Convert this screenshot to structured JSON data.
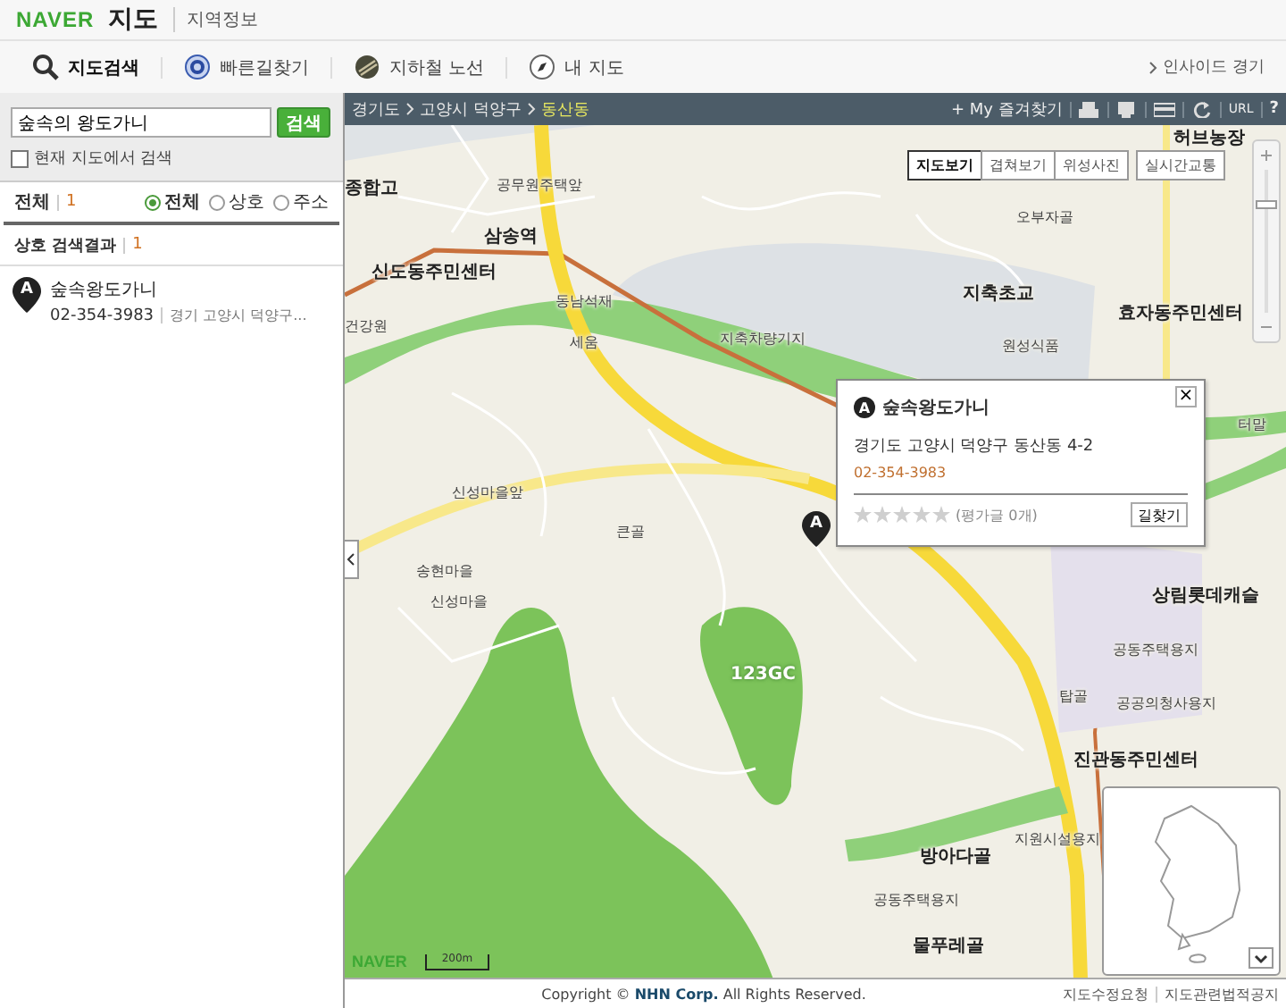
{
  "header": {
    "logo": "NAVER",
    "title": "지도",
    "subtitle": "지역정보"
  },
  "nav": {
    "items": [
      {
        "label": "지도검색",
        "selected": true
      },
      {
        "label": "빠른길찾기",
        "selected": false
      },
      {
        "label": "지하철 노선",
        "selected": false
      },
      {
        "label": "내 지도",
        "selected": false
      }
    ],
    "right_link": "인사이드 경기"
  },
  "search": {
    "value": "숲속의 왕도가니",
    "button": "검색",
    "scope_checkbox": {
      "label": "현재 지도에서 검색",
      "checked": false
    }
  },
  "filter": {
    "label": "전체",
    "count": "1",
    "options": [
      {
        "label": "전체",
        "selected": true
      },
      {
        "label": "상호",
        "selected": false
      },
      {
        "label": "주소",
        "selected": false
      }
    ]
  },
  "results": {
    "heading": "상호 검색결과",
    "count": "1",
    "items": [
      {
        "marker": "A",
        "name": "숲속왕도가니",
        "phone": "02-354-3983",
        "address": "경기 고양시 덕양구..."
      }
    ]
  },
  "map_toolbar": {
    "breadcrumb": [
      {
        "label": "경기도",
        "selected": false
      },
      {
        "label": "고양시 덕양구",
        "selected": false
      },
      {
        "label": "동산동",
        "selected": true
      }
    ],
    "favorites": "+ My 즐겨찾기",
    "url": "URL",
    "help": "?"
  },
  "map_types": [
    {
      "label": "지도보기",
      "selected": true
    },
    {
      "label": "겹쳐보기",
      "selected": false
    },
    {
      "label": "위성사진",
      "selected": false
    },
    {
      "label": "실시간교통",
      "selected": false
    }
  ],
  "map_labels": [
    {
      "text": "허브농장",
      "kind": "major"
    },
    {
      "text": "종합고",
      "kind": "major"
    },
    {
      "text": "공무원주택앞",
      "kind": "minor"
    },
    {
      "text": "삼송역",
      "kind": "major"
    },
    {
      "text": "신도동주민센터",
      "kind": "major"
    },
    {
      "text": "동남석재",
      "kind": "minor"
    },
    {
      "text": "건강원",
      "kind": "minor"
    },
    {
      "text": "세움",
      "kind": "minor"
    },
    {
      "text": "지축차량기지",
      "kind": "minor"
    },
    {
      "text": "오부자골",
      "kind": "minor"
    },
    {
      "text": "지축초교",
      "kind": "major"
    },
    {
      "text": "효자동주민센터",
      "kind": "major"
    },
    {
      "text": "원성식품",
      "kind": "minor"
    },
    {
      "text": "터말",
      "kind": "minor"
    },
    {
      "text": "신성마을앞",
      "kind": "minor"
    },
    {
      "text": "큰골",
      "kind": "minor"
    },
    {
      "text": "송현마을",
      "kind": "minor"
    },
    {
      "text": "신성마을",
      "kind": "minor"
    },
    {
      "text": "123GC",
      "kind": "golf"
    },
    {
      "text": "상림롯데캐슬",
      "kind": "major"
    },
    {
      "text": "공동주택용지",
      "kind": "minor"
    },
    {
      "text": "탑골",
      "kind": "minor"
    },
    {
      "text": "공공의청사용지",
      "kind": "minor"
    },
    {
      "text": "진관동주민센터",
      "kind": "major"
    },
    {
      "text": "지원시설용지",
      "kind": "minor"
    },
    {
      "text": "방아다골",
      "kind": "major"
    },
    {
      "text": "공동주택용지",
      "kind": "minor"
    },
    {
      "text": "물푸레골",
      "kind": "major"
    }
  ],
  "map_marker": "A",
  "zoom": {
    "level": 0.75
  },
  "popup": {
    "marker": "A",
    "name": "숲속왕도가니",
    "address": "경기도 고양시 덕양구 동산동 4-2",
    "phone": "02-354-3983",
    "stars": 0,
    "reviews": "(평가글 0개)",
    "button": "길찾기",
    "close": "×"
  },
  "map_logo": "NAVER",
  "scale": "200m",
  "footer": {
    "copyright_prefix": "Copyright ©",
    "company": "NHN Corp.",
    "copyright_suffix": "All Rights Reserved.",
    "links": [
      "지도수정요청",
      "지도관련법적공지"
    ]
  }
}
